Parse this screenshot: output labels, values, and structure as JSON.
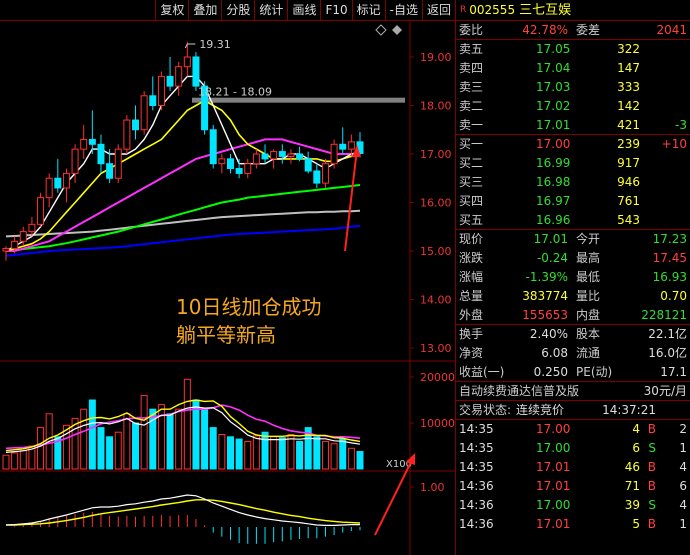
{
  "toolbar": {
    "buttons": [
      "复权",
      "叠加",
      "分股",
      "统计",
      "画线",
      "F10",
      "标记",
      "-自选",
      "返回"
    ]
  },
  "stock": {
    "code": "002555",
    "name": "三七互娱"
  },
  "main_chart": {
    "y_ticks": [
      "19.00",
      "18.00",
      "17.00",
      "16.00",
      "15.00",
      "14.00",
      "13.00"
    ],
    "high_label": "19.31",
    "range_label": "18.21 - 18.09",
    "annotation_line1": "10日线加仓成功",
    "annotation_line2": "躺平等新高",
    "colors": {
      "up": "#ff3030",
      "down": "#00e5ff",
      "ma5": "#ffffff",
      "ma10": "#ffff00",
      "ma20": "#ff30ff",
      "ma60": "#00ff00",
      "ma120": "#c0c0c0",
      "ma250": "#0000ff",
      "annotation": "#f5a71f"
    }
  },
  "volume_chart": {
    "y_ticks": [
      "20000",
      "10000"
    ],
    "unit": "X100"
  },
  "macd_chart": {
    "y_ticks": [
      "1.00"
    ]
  },
  "chart_data": {
    "type": "candlestick",
    "candles": [
      [
        15.0,
        15.1,
        14.8,
        15.05
      ],
      [
        15.05,
        15.3,
        14.95,
        15.2
      ],
      [
        15.2,
        15.5,
        15.1,
        15.4
      ],
      [
        15.4,
        15.7,
        15.3,
        15.55
      ],
      [
        15.55,
        16.2,
        15.5,
        16.1
      ],
      [
        16.1,
        16.6,
        15.9,
        16.5
      ],
      [
        16.5,
        16.9,
        16.2,
        16.3
      ],
      [
        16.3,
        16.7,
        16.0,
        16.6
      ],
      [
        16.6,
        17.2,
        16.4,
        17.1
      ],
      [
        17.1,
        17.6,
        16.9,
        17.3
      ],
      [
        17.3,
        17.9,
        17.0,
        17.2
      ],
      [
        17.2,
        17.4,
        16.6,
        16.8
      ],
      [
        16.8,
        17.1,
        16.4,
        16.5
      ],
      [
        16.5,
        17.2,
        16.4,
        17.1
      ],
      [
        17.1,
        17.8,
        17.0,
        17.7
      ],
      [
        17.7,
        18.0,
        17.3,
        17.5
      ],
      [
        17.5,
        18.3,
        17.4,
        18.2
      ],
      [
        18.2,
        18.6,
        17.9,
        18.0
      ],
      [
        18.0,
        18.7,
        17.9,
        18.6
      ],
      [
        18.6,
        19.0,
        18.3,
        18.4
      ],
      [
        18.4,
        18.9,
        18.2,
        18.8
      ],
      [
        18.8,
        19.31,
        18.6,
        19.0
      ],
      [
        19.0,
        19.1,
        18.3,
        18.4
      ],
      [
        18.4,
        18.5,
        17.4,
        17.5
      ],
      [
        17.5,
        17.6,
        16.7,
        16.8
      ],
      [
        16.8,
        17.0,
        16.6,
        16.9
      ],
      [
        16.9,
        17.0,
        16.6,
        16.7
      ],
      [
        16.7,
        16.9,
        16.5,
        16.6
      ],
      [
        16.6,
        16.9,
        16.5,
        16.8
      ],
      [
        16.8,
        17.1,
        16.7,
        17.0
      ],
      [
        17.0,
        17.2,
        16.8,
        16.9
      ],
      [
        16.9,
        17.1,
        16.7,
        17.05
      ],
      [
        17.05,
        17.2,
        16.8,
        16.95
      ],
      [
        16.95,
        17.1,
        16.8,
        17.0
      ],
      [
        17.0,
        17.15,
        16.85,
        16.9
      ],
      [
        16.9,
        17.05,
        16.6,
        16.65
      ],
      [
        16.65,
        16.8,
        16.3,
        16.4
      ],
      [
        16.4,
        16.9,
        16.3,
        16.8
      ],
      [
        16.8,
        17.3,
        16.7,
        17.2
      ],
      [
        17.2,
        17.55,
        17.0,
        17.1
      ],
      [
        17.1,
        17.4,
        16.95,
        17.25
      ],
      [
        17.25,
        17.45,
        16.93,
        17.01
      ]
    ],
    "ma5": [
      15.0,
      15.1,
      15.2,
      15.3,
      15.5,
      15.8,
      16.1,
      16.4,
      16.6,
      16.8,
      17.1,
      17.1,
      17.0,
      17.0,
      17.0,
      17.1,
      17.3,
      17.6,
      18.0,
      18.2,
      18.4,
      18.6,
      18.6,
      18.4,
      18.0,
      17.6,
      17.2,
      16.8,
      16.8,
      16.8,
      16.8,
      16.9,
      16.9,
      17.0,
      17.0,
      16.9,
      16.8,
      16.7,
      16.8,
      16.9,
      17.0,
      17.05
    ],
    "ma10": [
      15.0,
      15.05,
      15.1,
      15.15,
      15.25,
      15.4,
      15.6,
      15.8,
      16.0,
      16.2,
      16.4,
      16.6,
      16.7,
      16.8,
      16.9,
      17.0,
      17.1,
      17.2,
      17.3,
      17.5,
      17.7,
      17.9,
      18.0,
      18.1,
      18.0,
      17.9,
      17.7,
      17.4,
      17.2,
      17.1,
      17.0,
      16.9,
      16.9,
      16.9,
      16.9,
      16.9,
      16.9,
      16.85,
      16.85,
      16.9,
      16.95,
      17.0
    ],
    "ma20": [
      15.0,
      15.0,
      15.05,
      15.1,
      15.15,
      15.2,
      15.3,
      15.4,
      15.5,
      15.6,
      15.7,
      15.8,
      15.9,
      16.0,
      16.1,
      16.2,
      16.3,
      16.4,
      16.5,
      16.6,
      16.7,
      16.8,
      16.9,
      16.95,
      17.0,
      17.05,
      17.1,
      17.15,
      17.2,
      17.25,
      17.3,
      17.3,
      17.3,
      17.25,
      17.2,
      17.15,
      17.1,
      17.05,
      17.0,
      17.0,
      17.0,
      17.0
    ],
    "ma60": [
      15.0,
      15.02,
      15.04,
      15.06,
      15.08,
      15.1,
      15.13,
      15.16,
      15.2,
      15.24,
      15.28,
      15.32,
      15.36,
      15.4,
      15.45,
      15.5,
      15.55,
      15.6,
      15.65,
      15.7,
      15.75,
      15.8,
      15.85,
      15.9,
      15.95,
      16.0,
      16.03,
      16.06,
      16.1,
      16.12,
      16.14,
      16.16,
      16.18,
      16.2,
      16.22,
      16.24,
      16.26,
      16.28,
      16.3,
      16.32,
      16.34,
      16.36
    ],
    "ma120": [
      15.3,
      15.31,
      15.32,
      15.33,
      15.34,
      15.35,
      15.36,
      15.37,
      15.38,
      15.39,
      15.4,
      15.42,
      15.44,
      15.46,
      15.48,
      15.5,
      15.52,
      15.54,
      15.56,
      15.58,
      15.6,
      15.62,
      15.64,
      15.66,
      15.68,
      15.7,
      15.71,
      15.72,
      15.73,
      15.74,
      15.75,
      15.76,
      15.77,
      15.78,
      15.79,
      15.8,
      15.8,
      15.81,
      15.81,
      15.82,
      15.82,
      15.83
    ],
    "ma250": [
      14.9,
      14.92,
      14.94,
      14.96,
      14.98,
      15.0,
      15.01,
      15.02,
      15.03,
      15.04,
      15.05,
      15.06,
      15.07,
      15.08,
      15.1,
      15.12,
      15.14,
      15.16,
      15.18,
      15.2,
      15.22,
      15.24,
      15.26,
      15.28,
      15.3,
      15.32,
      15.34,
      15.35,
      15.36,
      15.37,
      15.38,
      15.39,
      15.4,
      15.41,
      15.42,
      15.43,
      15.44,
      15.45,
      15.46,
      15.48,
      15.5,
      15.52
    ],
    "volume": [
      3000,
      3500,
      4000,
      5000,
      9000,
      12000,
      7000,
      9500,
      11000,
      13000,
      15000,
      9000,
      7000,
      8000,
      12000,
      10000,
      16000,
      13000,
      14000,
      12000,
      13000,
      19500,
      15000,
      13000,
      9000,
      7500,
      7000,
      6500,
      6000,
      7200,
      8000,
      7000,
      6800,
      7500,
      6000,
      9000,
      7000,
      6000,
      5500,
      6500,
      4500,
      3800
    ],
    "vol_ma5": [
      4000,
      4200,
      4400,
      4800,
      5500,
      6700,
      7400,
      8500,
      9700,
      10500,
      11100,
      11200,
      10900,
      11400,
      12200,
      11000,
      10600,
      11800,
      13000,
      13000,
      14000,
      14700,
      15000,
      14700,
      14800,
      13600,
      11400,
      9900,
      8200,
      7400,
      7100,
      7100,
      7100,
      7300,
      7200,
      7400,
      7300,
      7300,
      6800,
      6700,
      6300,
      6000
    ],
    "vol_ma10": [
      4500,
      4600,
      4700,
      4900,
      5200,
      5600,
      6000,
      6700,
      7500,
      8200,
      9000,
      9800,
      10200,
      10500,
      10900,
      11100,
      11100,
      11300,
      11600,
      11900,
      12500,
      12800,
      13000,
      13000,
      13300,
      13900,
      13500,
      12800,
      11700,
      10800,
      10400,
      9500,
      8800,
      8300,
      8000,
      7800,
      7300,
      7200,
      7000,
      7000,
      6900,
      6700
    ],
    "dif": [
      0.05,
      0.06,
      0.08,
      0.1,
      0.14,
      0.2,
      0.25,
      0.3,
      0.36,
      0.42,
      0.48,
      0.5,
      0.5,
      0.52,
      0.56,
      0.58,
      0.62,
      0.65,
      0.7,
      0.72,
      0.76,
      0.8,
      0.78,
      0.7,
      0.6,
      0.52,
      0.44,
      0.36,
      0.3,
      0.25,
      0.21,
      0.18,
      0.15,
      0.13,
      0.11,
      0.08,
      0.05,
      0.04,
      0.04,
      0.05,
      0.06,
      0.06
    ],
    "dea": [
      0.05,
      0.05,
      0.06,
      0.07,
      0.08,
      0.1,
      0.13,
      0.16,
      0.2,
      0.24,
      0.29,
      0.33,
      0.36,
      0.39,
      0.42,
      0.45,
      0.48,
      0.51,
      0.55,
      0.58,
      0.61,
      0.65,
      0.68,
      0.68,
      0.67,
      0.64,
      0.6,
      0.56,
      0.51,
      0.46,
      0.42,
      0.37,
      0.33,
      0.29,
      0.26,
      0.22,
      0.19,
      0.16,
      0.14,
      0.12,
      0.11,
      0.1
    ]
  },
  "quote": {
    "webi_label": "委比",
    "webi": "42.78%",
    "weicha_label": "委差",
    "weicha": "2041",
    "asks": [
      {
        "label": "卖五",
        "price": "17.05",
        "vol": "322",
        "chg": ""
      },
      {
        "label": "卖四",
        "price": "17.04",
        "vol": "147",
        "chg": ""
      },
      {
        "label": "卖三",
        "price": "17.03",
        "vol": "333",
        "chg": ""
      },
      {
        "label": "卖二",
        "price": "17.02",
        "vol": "142",
        "chg": ""
      },
      {
        "label": "卖一",
        "price": "17.01",
        "vol": "421",
        "chg": "-3"
      }
    ],
    "bids": [
      {
        "label": "买一",
        "price": "17.00",
        "vol": "239",
        "chg": "+10"
      },
      {
        "label": "买二",
        "price": "16.99",
        "vol": "917",
        "chg": ""
      },
      {
        "label": "买三",
        "price": "16.98",
        "vol": "946",
        "chg": ""
      },
      {
        "label": "买四",
        "price": "16.97",
        "vol": "761",
        "chg": ""
      },
      {
        "label": "买五",
        "price": "16.96",
        "vol": "543",
        "chg": ""
      }
    ],
    "stats": [
      {
        "l1": "现价",
        "v1": "17.01",
        "c1": "green",
        "l2": "今开",
        "v2": "17.23",
        "c2": "green"
      },
      {
        "l1": "涨跌",
        "v1": "-0.24",
        "c1": "green",
        "l2": "最高",
        "v2": "17.45",
        "c2": "red"
      },
      {
        "l1": "涨幅",
        "v1": "-1.39%",
        "c1": "green",
        "l2": "最低",
        "v2": "16.93",
        "c2": "green"
      },
      {
        "l1": "总量",
        "v1": "383774",
        "c1": "yel",
        "l2": "量比",
        "v2": "0.70",
        "c2": "yel"
      },
      {
        "l1": "外盘",
        "v1": "155653",
        "c1": "red",
        "l2": "内盘",
        "v2": "228121",
        "c2": "green"
      }
    ],
    "stats2": [
      {
        "l1": "换手",
        "v1": "2.40%",
        "l2": "股本",
        "v2": "22.1亿"
      },
      {
        "l1": "净资",
        "v1": "6.08",
        "l2": "流通",
        "v2": "16.0亿"
      },
      {
        "l1": "收益(一)",
        "v1": "0.250",
        "l2": "PE(动)",
        "v2": "17.1"
      }
    ],
    "promo": "自动续费通达信普及版",
    "promo_price": "30元/月",
    "status_label": "交易状态:",
    "status_value": "连续竞价",
    "status_time": "14:37:21",
    "ticks": [
      {
        "time": "14:35",
        "price": "17.00",
        "vol": "4",
        "bs": "B",
        "cnt": "2"
      },
      {
        "time": "14:35",
        "price": "17.00",
        "vol": "6",
        "bs": "S",
        "cnt": "1"
      },
      {
        "time": "14:35",
        "price": "17.01",
        "vol": "46",
        "bs": "B",
        "cnt": "4"
      },
      {
        "time": "14:36",
        "price": "17.01",
        "vol": "71",
        "bs": "B",
        "cnt": "6"
      },
      {
        "time": "14:36",
        "price": "17.00",
        "vol": "39",
        "bs": "S",
        "cnt": "4"
      },
      {
        "time": "14:36",
        "price": "17.01",
        "vol": "5",
        "bs": "B",
        "cnt": "1"
      }
    ]
  }
}
